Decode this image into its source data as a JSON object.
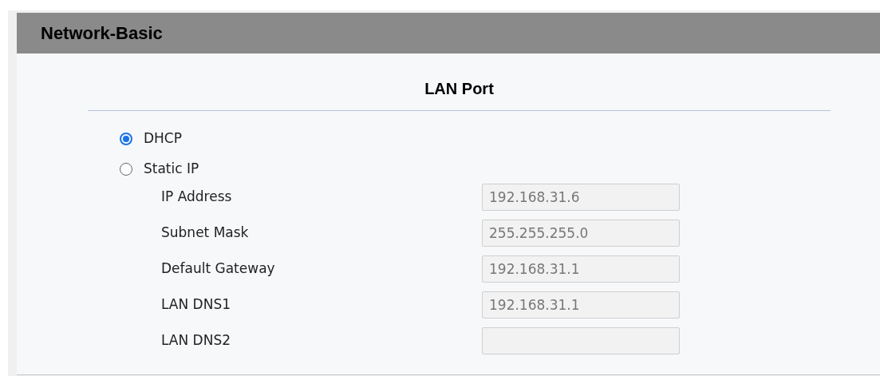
{
  "header": {
    "title": "Network-Basic"
  },
  "section": {
    "title": "LAN Port"
  },
  "modes": [
    {
      "label": "DHCP",
      "selected": true
    },
    {
      "label": "Static IP",
      "selected": false
    }
  ],
  "fields": [
    {
      "label": "IP Address",
      "value": "192.168.31.6",
      "disabled": true
    },
    {
      "label": "Subnet Mask",
      "value": "255.255.255.0",
      "disabled": true
    },
    {
      "label": "Default Gateway",
      "value": "192.168.31.1",
      "disabled": true
    },
    {
      "label": "LAN DNS1",
      "value": "192.168.31.1",
      "disabled": true
    },
    {
      "label": "LAN DNS2",
      "disabled": true
    }
  ]
}
